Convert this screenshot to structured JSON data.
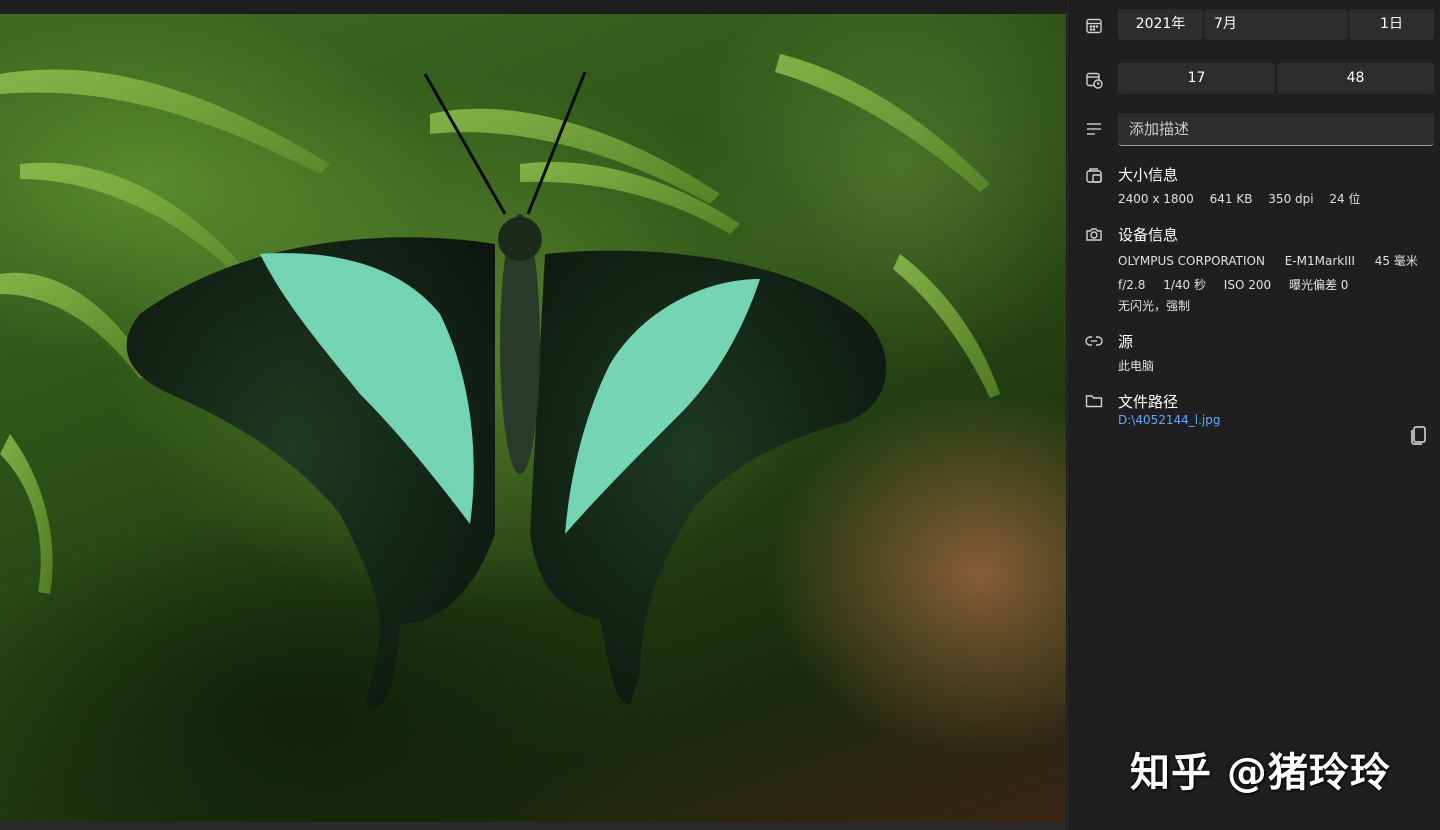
{
  "image": {
    "alt_icon": "butterfly-photo"
  },
  "date": {
    "year": "2021年",
    "month": "7月",
    "day": "1日"
  },
  "time": {
    "hour": "17",
    "minute": "48"
  },
  "description": {
    "placeholder": "添加描述"
  },
  "size_info": {
    "title": "大小信息",
    "dimensions": "2400 x 1800",
    "file_size": "641 KB",
    "dpi": "350 dpi",
    "bit_depth": "24 位"
  },
  "device_info": {
    "title": "设备信息",
    "maker": "OLYMPUS CORPORATION",
    "model": "E-M1MarkIII",
    "focal_length": "45 毫米",
    "aperture": "f/2.8",
    "shutter": "1/40 秒",
    "iso": "ISO 200",
    "exposure_bias": "曝光偏差 0",
    "flash": "无闪光，强制"
  },
  "source": {
    "title": "源",
    "value": "此电脑"
  },
  "file_path": {
    "title": "文件路径",
    "value": "D:\\4052144_l.jpg"
  },
  "watermark": "知乎 @猪玲玲",
  "colors": {
    "panel_bg": "#1f1f1f",
    "field_bg": "#2d2d2d",
    "link": "#5fa8ff"
  }
}
